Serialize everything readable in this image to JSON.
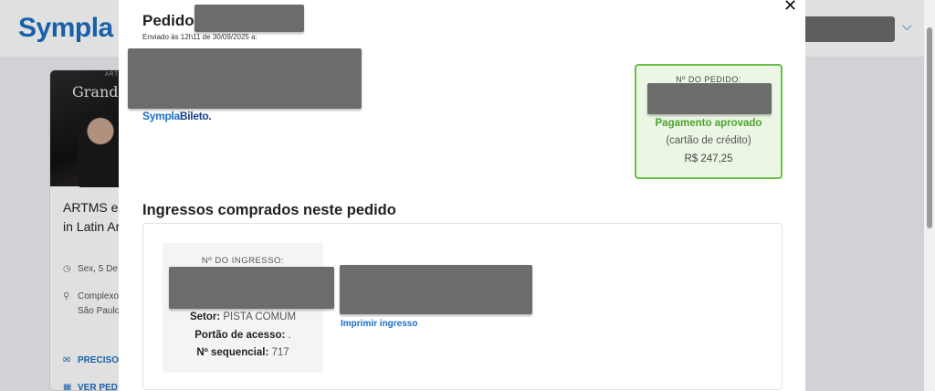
{
  "header": {
    "logo": "Sympla"
  },
  "event": {
    "banner_title": "Grand C",
    "banner_small": "ARTM",
    "title": "ARTMS em  in Latin Ar",
    "title_line1": "ARTMS em",
    "title_line2": "in Latin Ar",
    "date": "Sex, 5 De",
    "place_line1": "Complexo",
    "place_line2": "São Paulo",
    "link1": "PRECISO",
    "link2": "VER PED"
  },
  "modal": {
    "title": "Pedido",
    "sent_text": "Enviado às 12h11 de 30/09/2025 a:",
    "brand_left": "Sympla",
    "brand_right": "Bileto.",
    "order_number_label": "Nº DO PEDIDO:",
    "payment_status": "Pagamento aprovado",
    "payment_method": "(cartão de crédito)",
    "total": "R$ 247,25",
    "section_title": "Ingressos comprados neste pedido",
    "ticket": {
      "number_label": "Nº DO INGRESSO:",
      "sector_label": "Setor:",
      "sector_value": "PISTA COMUM",
      "gate_label": "Portão de acesso:",
      "gate_value": ".",
      "seq_label": "Nº sequencial:",
      "seq_value": "717",
      "print_link": "Imprimir ingresso"
    },
    "close_symbol": "✕"
  },
  "colors": {
    "brand_blue": "#1b6ec2",
    "approved_green": "#4aa52d",
    "approved_border": "#6cc04a",
    "approved_bg": "#ebf7e4"
  },
  "icons": [
    "chevron-down-icon",
    "clock-icon",
    "location-pin-icon",
    "mail-icon",
    "ticket-icon",
    "close-icon"
  ]
}
